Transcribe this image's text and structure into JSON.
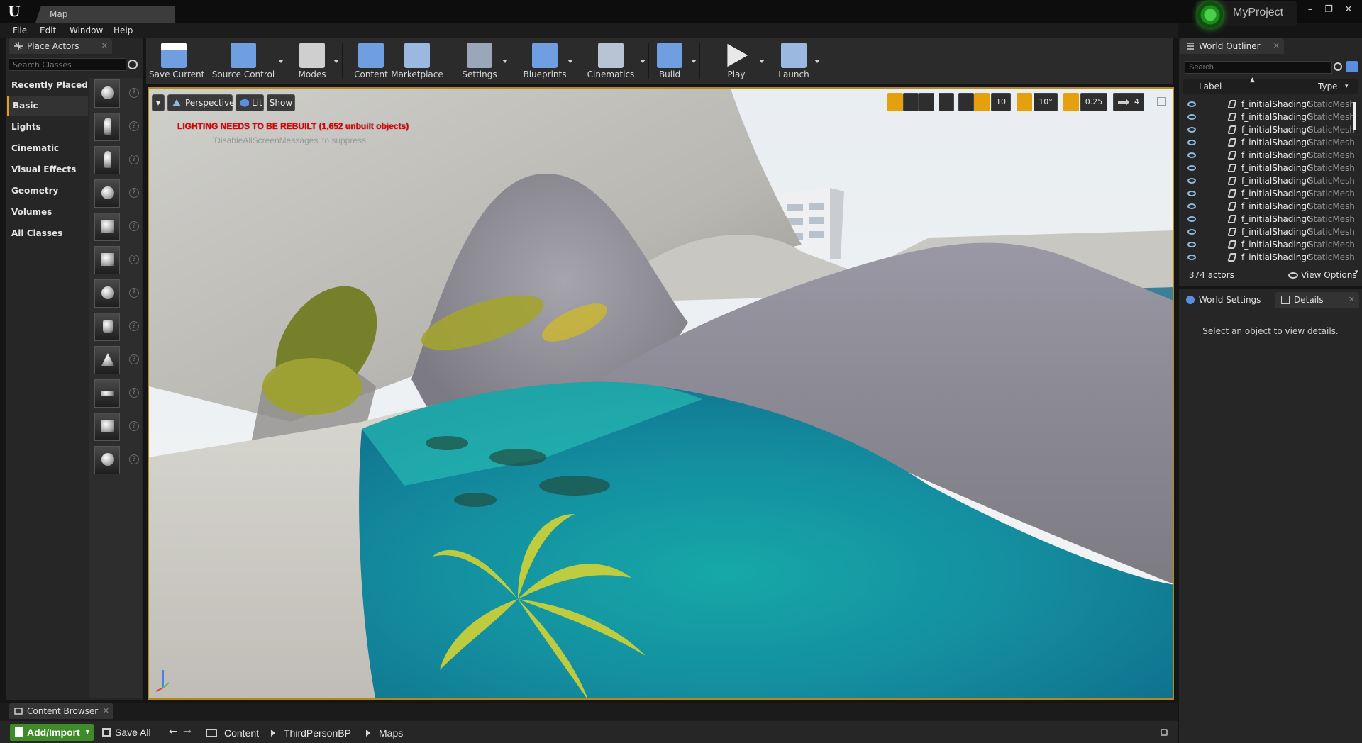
{
  "titlebar": {
    "document_tab": "Map",
    "project_name": "MyProject",
    "controls": [
      "minimize-icon",
      "restore-icon",
      "close-icon"
    ]
  },
  "menu": [
    "File",
    "Edit",
    "Window",
    "Help"
  ],
  "place_actors": {
    "tab_label": "Place Actors",
    "search_placeholder": "Search Classes",
    "categories": [
      "Recently Placed",
      "Basic",
      "Lights",
      "Cinematic",
      "Visual Effects",
      "Geometry",
      "Volumes",
      "All Classes"
    ],
    "active_category": "Basic",
    "actor_icons": [
      "sphere-icon",
      "mannequin-icon",
      "player-start-icon",
      "point-light-icon",
      "trigger-icon",
      "cube-icon",
      "sphere-icon",
      "cylinder-icon",
      "cone-icon",
      "plane-icon",
      "box-trigger-icon",
      "sphere-trigger-icon"
    ]
  },
  "toolbar": {
    "buttons": [
      {
        "label": "Save Current",
        "icon": "save-icon"
      },
      {
        "label": "Source Control",
        "icon": "source-control-icon"
      },
      {
        "label": "Modes",
        "icon": "modes-icon"
      },
      {
        "label": "Content",
        "icon": "content-icon"
      },
      {
        "label": "Marketplace",
        "icon": "marketplace-icon"
      },
      {
        "label": "Settings",
        "icon": "settings-icon"
      },
      {
        "label": "Blueprints",
        "icon": "blueprints-icon"
      },
      {
        "label": "Cinematics",
        "icon": "cinematics-icon"
      },
      {
        "label": "Build",
        "icon": "build-icon"
      },
      {
        "label": "Play",
        "icon": "play-icon"
      },
      {
        "label": "Launch",
        "icon": "launch-icon"
      }
    ]
  },
  "viewport": {
    "view_mode": "Perspective",
    "lighting_mode": "Lit",
    "show_label": "Show",
    "warning": "LIGHTING NEEDS TO BE REBUILT (1,652 unbuilt objects)",
    "suppress_hint": "'DisableAllScreenMessages' to suppress",
    "grid_snap": "10",
    "rotation_snap": "10°",
    "scale_snap": "0.25",
    "camera_speed": "4",
    "border_color": "#b58a16"
  },
  "world_outliner": {
    "tab_label": "World Outliner",
    "search_placeholder": "Search...",
    "col_label": "Label",
    "col_type": "Type",
    "rows": [
      {
        "label": "f_initialShadingG",
        "type": "StaticMesh"
      },
      {
        "label": "f_initialShadingG",
        "type": "StaticMesh"
      },
      {
        "label": "f_initialShadingG",
        "type": "StaticMesh"
      },
      {
        "label": "f_initialShadingG",
        "type": "StaticMesh"
      },
      {
        "label": "f_initialShadingG",
        "type": "StaticMesh"
      },
      {
        "label": "f_initialShadingG",
        "type": "StaticMesh"
      },
      {
        "label": "f_initialShadingG",
        "type": "StaticMesh"
      },
      {
        "label": "f_initialShadingG",
        "type": "StaticMesh"
      },
      {
        "label": "f_initialShadingG",
        "type": "StaticMesh"
      },
      {
        "label": "f_initialShadingG",
        "type": "StaticMesh"
      },
      {
        "label": "f_initialShadingG",
        "type": "StaticMesh"
      },
      {
        "label": "f_initialShadingG",
        "type": "StaticMesh"
      },
      {
        "label": "f_initialShadingG",
        "type": "StaticMesh"
      }
    ],
    "actor_count": "374 actors",
    "view_options": "View Options"
  },
  "details": {
    "world_settings_tab": "World Settings",
    "details_tab": "Details",
    "empty_message": "Select an object to view details."
  },
  "content_browser": {
    "tab_label": "Content Browser",
    "add_import": "Add/Import",
    "save_all": "Save All",
    "breadcrumbs": [
      "Content",
      "ThirdPersonBP",
      "Maps"
    ]
  },
  "colors": {
    "accent": "#e5a00d",
    "background": "#262626",
    "warning": "#e00000",
    "add_button": "#3d8c27"
  }
}
